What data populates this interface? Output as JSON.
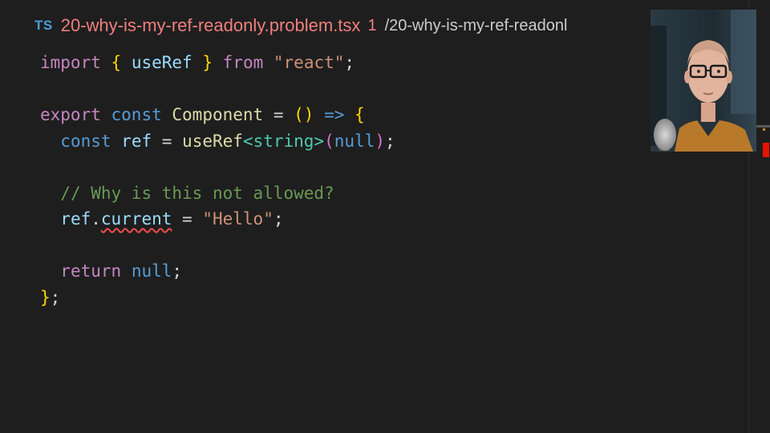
{
  "tab": {
    "icon_label": "TS",
    "filename": "20-why-is-my-ref-readonly.problem.tsx",
    "problem_count": "1",
    "path": "/20-why-is-my-ref-readonl"
  },
  "code": {
    "l1": {
      "t1": "import",
      "t2": " ",
      "t3": "{",
      "t4": " ",
      "t5": "useRef",
      "t6": " ",
      "t7": "}",
      "t8": " ",
      "t9": "from",
      "t10": " ",
      "t11": "\"react\"",
      "t12": ";"
    },
    "l3": {
      "t1": "export",
      "t2": " ",
      "t3": "const",
      "t4": " ",
      "t5": "Component",
      "t6": " = ",
      "t7": "()",
      "t8": " ",
      "t9": "=>",
      "t10": " ",
      "t11": "{"
    },
    "l4": {
      "t1": "  ",
      "t2": "const",
      "t3": " ",
      "t4": "ref",
      "t5": " = ",
      "t6": "useRef",
      "t7": "<",
      "t8": "string",
      "t9": ">",
      "t10": "(",
      "t11": "null",
      "t12": ")",
      "t13": ";"
    },
    "l6": {
      "t1": "  ",
      "t2": "// Why is this not allowed?"
    },
    "l7": {
      "t1": "  ",
      "t2": "ref",
      "t3": ".",
      "t4": "current",
      "t5": " = ",
      "t6": "\"Hello\"",
      "t7": ";"
    },
    "l9": {
      "t1": "  ",
      "t2": "return",
      "t3": " ",
      "t4": "null",
      "t5": ";"
    },
    "l10": {
      "t1": "}",
      "t2": ";"
    }
  },
  "colors": {
    "background": "#1e1e1e",
    "error": "#f14c4c",
    "tab_filename": "#f07f7f"
  }
}
